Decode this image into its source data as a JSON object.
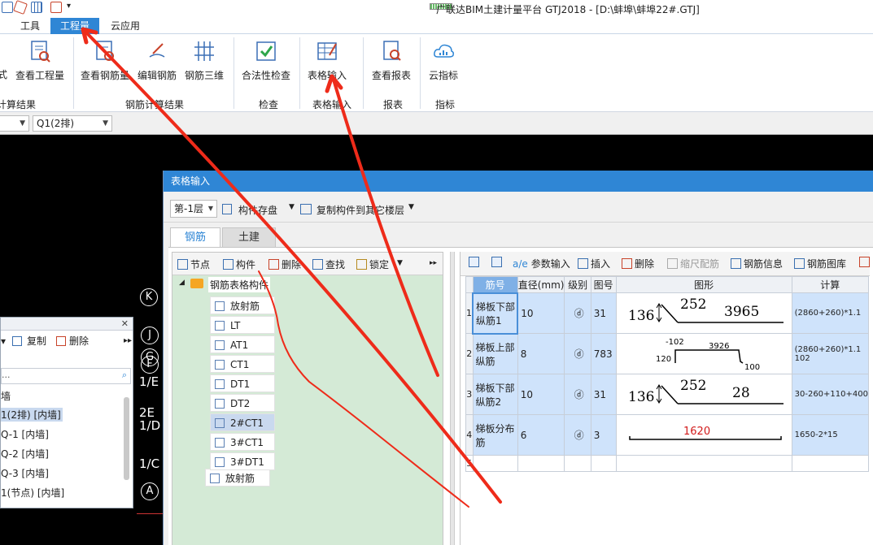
{
  "titlebar": {
    "title": "广联达BIM土建计量平台 GTJ2018 - [D:\\蚌埠\\蚌埠22#.GTJ]"
  },
  "menu": {
    "tabs": [
      {
        "label": "工具",
        "active": false
      },
      {
        "label": "工程量",
        "active": true
      },
      {
        "label": "云应用",
        "active": false
      }
    ]
  },
  "ribbon": {
    "buttons": [
      {
        "label": "式",
        "icon": "formula-icon"
      },
      {
        "label": "查看工程量",
        "icon": "view-quantity-icon"
      },
      {
        "label": "查看钢筋量",
        "icon": "view-rebar-quantity-icon"
      },
      {
        "label": "编辑钢筋",
        "icon": "edit-rebar-icon"
      },
      {
        "label": "钢筋三维",
        "icon": "rebar-3d-icon"
      },
      {
        "label": "合法性检查",
        "icon": "validity-check-icon"
      },
      {
        "label": "表格输入",
        "icon": "table-input-icon"
      },
      {
        "label": "查看报表",
        "icon": "view-report-icon"
      },
      {
        "label": "云指标",
        "icon": "cloud-index-icon"
      }
    ],
    "groups": [
      "计算结果",
      "钢筋计算结果",
      "检查",
      "表格输入",
      "报表",
      "指标"
    ]
  },
  "selbar": {
    "combo1": "",
    "combo2": "Q1(2排)"
  },
  "axes": [
    "K",
    "J",
    "G",
    "F",
    "A"
  ],
  "axis_texts": [
    "1/E",
    "2E",
    "1/D",
    "1/C"
  ],
  "left_panel": {
    "title": "",
    "toolbar": {
      "copy": "复制",
      "delete": "删除"
    },
    "search_placeholder": "...",
    "items": [
      {
        "label": "墙",
        "selected": false
      },
      {
        "label": "1(2排) [内墙]",
        "selected": true
      },
      {
        "label": "Q-1 [内墙]",
        "selected": false
      },
      {
        "label": "Q-2 [内墙]",
        "selected": false
      },
      {
        "label": "Q-3 [内墙]",
        "selected": false
      },
      {
        "label": "1(节点) [内墙]",
        "selected": false
      }
    ]
  },
  "dialog": {
    "title": "表格输入",
    "floor": "第-1层",
    "save_components": "构件存盘",
    "copy_to_floors": "复制构件到其它楼层",
    "tabs": [
      {
        "label": "钢筋",
        "active": true
      },
      {
        "label": "土建",
        "active": false
      }
    ],
    "tree_toolbar": {
      "node": "节点",
      "component": "构件",
      "delete": "删除",
      "find": "查找",
      "lock": "锁定"
    },
    "tree": {
      "root": "钢筋表格构件",
      "items": [
        {
          "label": "放射筋",
          "selected": false
        },
        {
          "label": "LT",
          "selected": false
        },
        {
          "label": "AT1",
          "selected": false
        },
        {
          "label": "CT1",
          "selected": false
        },
        {
          "label": "DT1",
          "selected": false
        },
        {
          "label": "DT2",
          "selected": false
        },
        {
          "label": "2#CT1",
          "selected": true
        },
        {
          "label": "3#CT1",
          "selected": false
        },
        {
          "label": "3#DT1",
          "selected": false
        }
      ]
    },
    "grid_toolbar": {
      "param_input": "参数输入",
      "insert": "插入",
      "delete": "删除",
      "scale_rebar": "缩尺配筋",
      "rebar_info": "钢筋信息",
      "rebar_library": "钢筋图库"
    },
    "grid": {
      "headers": [
        "筋号",
        "直径(mm)",
        "级别",
        "图号",
        "图形",
        "计算"
      ],
      "rows": [
        {
          "no": "1",
          "name": "梯板下部纵筋1",
          "dia": "10",
          "grade": "ⓓ",
          "fig": "31",
          "shape": {
            "a": "136",
            "b": "252",
            "c": "3965"
          },
          "calc": "(2860+260)*1.1"
        },
        {
          "no": "2",
          "name": "梯板上部纵筋",
          "dia": "8",
          "grade": "ⓓ",
          "fig": "783",
          "shape": {
            "a": "-102",
            "b": "3926",
            "c": "120",
            "d": "100"
          },
          "calc": "(2860+260)*1.1 102"
        },
        {
          "no": "3",
          "name": "梯板下部纵筋2",
          "dia": "10",
          "grade": "ⓓ",
          "fig": "31",
          "shape": {
            "a": "136",
            "b": "252",
            "c": "28"
          },
          "calc": "30-260+110+400"
        },
        {
          "no": "4",
          "name": "梯板分布筋",
          "dia": "6",
          "grade": "ⓓ",
          "fig": "3",
          "shape": {
            "a": "1620"
          },
          "calc": "1650-2*15"
        },
        {
          "no": "5",
          "name": "",
          "dia": "",
          "grade": "",
          "fig": "",
          "shape": {},
          "calc": ""
        }
      ]
    }
  },
  "colors": {
    "accent": "#2f86d5",
    "annotation": "#ee2b1a",
    "tree_bg": "#d4ead6",
    "selected_row": "#cfe3fb"
  }
}
